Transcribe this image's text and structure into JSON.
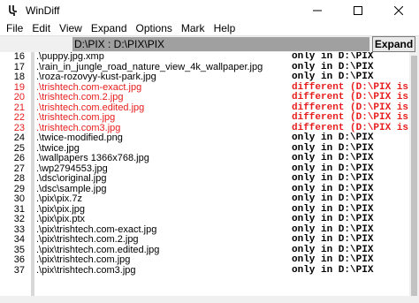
{
  "window": {
    "title": "WinDiff",
    "icon": "windiff-icon",
    "controls": [
      "minimize-icon",
      "maximize-icon",
      "close-icon"
    ]
  },
  "menu": [
    "File",
    "Edit",
    "View",
    "Expand",
    "Options",
    "Mark",
    "Help"
  ],
  "toolbar": {
    "path": "D:\\PIX : D:\\PIX\\PIX",
    "expand_label": "Expand"
  },
  "colors": {
    "different": "#e81c1c",
    "normal": "#000000",
    "path_bg": "#a0a0a0"
  },
  "rows": [
    {
      "num": "16",
      "name": ".\\puppy.jpg.xmp",
      "status": "only in D:\\PIX",
      "diff": false
    },
    {
      "num": "17",
      "name": ".\\rain_in_jungle_road_nature_view_4k_wallpaper.jpg",
      "status": "only in D:\\PIX",
      "diff": false
    },
    {
      "num": "18",
      "name": ".\\roza-rozovyy-kust-park.jpg",
      "status": "only in D:\\PIX",
      "diff": false
    },
    {
      "num": "19",
      "name": ".\\trishtech.com-exact.jpg",
      "status": "different (D:\\PIX is m",
      "diff": true
    },
    {
      "num": "20",
      "name": ".\\trishtech.com.2.jpg",
      "status": "different (D:\\PIX is m",
      "diff": true
    },
    {
      "num": "21",
      "name": ".\\trishtech.com.edited.jpg",
      "status": "different (D:\\PIX is m",
      "diff": true
    },
    {
      "num": "22",
      "name": ".\\trishtech.com.jpg",
      "status": "different (D:\\PIX is m",
      "diff": true
    },
    {
      "num": "23",
      "name": ".\\trishtech.com3.jpg",
      "status": "different (D:\\PIX is m",
      "diff": true
    },
    {
      "num": "24",
      "name": ".\\twice-modified.png",
      "status": "only in D:\\PIX",
      "diff": false
    },
    {
      "num": "25",
      "name": ".\\twice.jpg",
      "status": "only in D:\\PIX",
      "diff": false
    },
    {
      "num": "26",
      "name": ".\\wallpapers 1366x768.jpg",
      "status": "only in D:\\PIX",
      "diff": false
    },
    {
      "num": "27",
      "name": ".\\wp2794553.jpg",
      "status": "only in D:\\PIX",
      "diff": false
    },
    {
      "num": "28",
      "name": ".\\dsc\\original.jpg",
      "status": "only in D:\\PIX",
      "diff": false
    },
    {
      "num": "29",
      "name": ".\\dsc\\sample.jpg",
      "status": "only in D:\\PIX",
      "diff": false
    },
    {
      "num": "30",
      "name": ".\\pix\\pix.7z",
      "status": "only in D:\\PIX",
      "diff": false
    },
    {
      "num": "31",
      "name": ".\\pix\\pix.jpg",
      "status": "only in D:\\PIX",
      "diff": false
    },
    {
      "num": "32",
      "name": ".\\pix\\pix.ptx",
      "status": "only in D:\\PIX",
      "diff": false
    },
    {
      "num": "33",
      "name": ".\\pix\\trishtech.com-exact.jpg",
      "status": "only in D:\\PIX",
      "diff": false
    },
    {
      "num": "34",
      "name": ".\\pix\\trishtech.com.2.jpg",
      "status": "only in D:\\PIX",
      "diff": false
    },
    {
      "num": "35",
      "name": ".\\pix\\trishtech.com.edited.jpg",
      "status": "only in D:\\PIX",
      "diff": false
    },
    {
      "num": "36",
      "name": ".\\pix\\trishtech.com.jpg",
      "status": "only in D:\\PIX",
      "diff": false
    },
    {
      "num": "37",
      "name": ".\\pix\\trishtech.com3.jpg",
      "status": "only in D:\\PIX",
      "diff": false
    }
  ]
}
